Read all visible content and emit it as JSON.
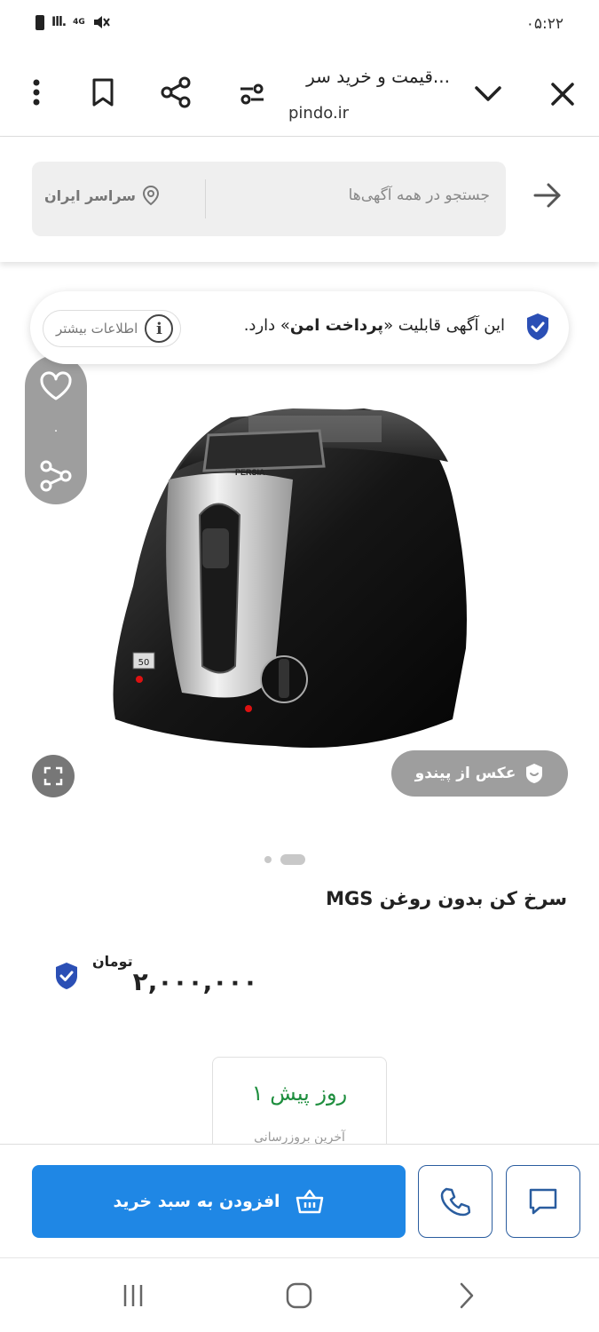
{
  "status_bar": {
    "time": "۰۵:۲۲",
    "network": "4G"
  },
  "toolbar": {
    "title": "قیمت و خرید سر...",
    "url": "pindo.ir"
  },
  "search": {
    "placeholder": "جستجو در همه آگهی‌ها",
    "location": "سراسر ایران"
  },
  "secure_banner": {
    "text_before": "این آگهی قابلیت «",
    "text_bold": "پرداخت امن",
    "text_after": "» دارد.",
    "more_info": "اطلاعات بیشتر"
  },
  "gallery": {
    "like_count": "۰",
    "photo_badge": "عکس از پیندو",
    "brand_label": "PERSIA",
    "display_digits": "50"
  },
  "product": {
    "title": "سرخ کن بدون روغن MGS",
    "price": "۲,۰۰۰,۰۰۰",
    "currency": "تومان"
  },
  "date_card": {
    "value": "۱ روز پیش",
    "label": "آخرین بروزرسانی"
  },
  "actions": {
    "add_to_cart": "افزودن به سبد خرید"
  },
  "colors": {
    "primary_blue": "#1f87e5",
    "shield_blue": "#2b4fb5",
    "date_green": "#1e8e3e"
  }
}
